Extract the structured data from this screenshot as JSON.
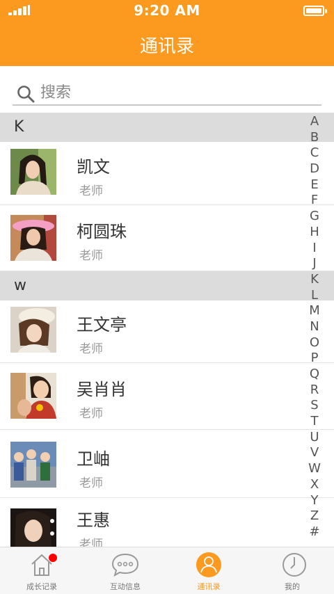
{
  "status_bar": {
    "time": "9:20 AM"
  },
  "header": {
    "title": "通讯录"
  },
  "search": {
    "placeholder": "搜索"
  },
  "sections": [
    {
      "letter": "K",
      "contacts": [
        {
          "name": "凯文",
          "role": "老师"
        },
        {
          "name": "柯圆珠",
          "role": "老师"
        }
      ]
    },
    {
      "letter": "w",
      "contacts": [
        {
          "name": "王文亭",
          "role": "老师"
        },
        {
          "name": "吴肖肖",
          "role": "老师"
        },
        {
          "name": "卫岫",
          "role": "老师"
        },
        {
          "name": "王惠",
          "role": "老师"
        }
      ]
    }
  ],
  "alpha_index": [
    "A",
    "B",
    "C",
    "D",
    "E",
    "F",
    "G",
    "H",
    "I",
    "J",
    "K",
    "L",
    "M",
    "N",
    "O",
    "P",
    "Q",
    "R",
    "S",
    "T",
    "U",
    "V",
    "W",
    "X",
    "Y",
    "Z",
    "#"
  ],
  "tabs": [
    {
      "label": "成长记录",
      "icon": "house-icon",
      "badge": true,
      "active": false
    },
    {
      "label": "互动信息",
      "icon": "chat-bubble-icon",
      "active": false
    },
    {
      "label": "通讯录",
      "icon": "person-icon",
      "active": true
    },
    {
      "label": "我的",
      "icon": "clock-icon",
      "active": false
    }
  ],
  "colors": {
    "brand": "#fb9a1f",
    "badge": "#ff0000",
    "section_bg": "#dcdcdc"
  }
}
